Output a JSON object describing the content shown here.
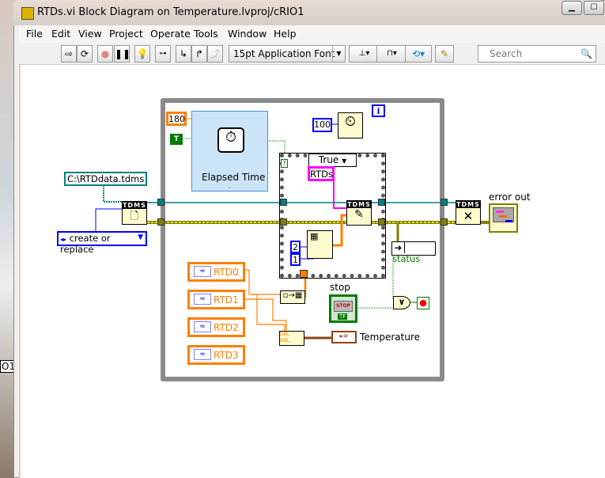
{
  "window": {
    "title": "RTDs.vi Block Diagram on Temperature.lvproj/cRIO1",
    "minimize": "▁",
    "maximize": "☐"
  },
  "menu": [
    "File",
    "Edit",
    "View",
    "Project",
    "Operate",
    "Tools",
    "Window",
    "Help"
  ],
  "toolbar": {
    "font_select": "15pt Application Font",
    "search_placeholder": "Search",
    "icons": [
      "run-arrow-icon",
      "run-continuously-icon",
      "abort-icon",
      "pause-icon",
      "highlight-execution-icon",
      "retain-wire-values-icon",
      "step-into-icon",
      "step-over-icon",
      "step-out-icon",
      "align-objects-icon",
      "distribute-objects-icon",
      "reorder-icon",
      "cleanup-diagram-icon",
      "search-icon"
    ]
  },
  "diagram": {
    "loop_index": "i",
    "const_180": "180",
    "const_true": "T",
    "elapsed_time": "Elapsed Time",
    "const_100": "100",
    "case_selector": "True",
    "rtds_const": "RTDs",
    "const_2": "2",
    "const_1": "1",
    "tdms": "TDMS",
    "path_const": "C:\\RTDdata.tdms",
    "enum_const": "create or replace",
    "error_out": "error out",
    "status": "status",
    "rtd": [
      "RTD0",
      "RTD1",
      "RTD2",
      "RTD3"
    ],
    "stop_label": "stop",
    "stop_button": "STOP",
    "stop_tf": "TF",
    "temperature": "Temperature",
    "dbl": "DBL",
    "or": "∨",
    "side_text": "O1"
  },
  "colors": {
    "loop": "#8a8a8a",
    "int_const": "#0000ff",
    "dbl_wire": "#ff7f00",
    "bool": "#007a00",
    "string": "#ff00ff",
    "refnum": "#008080",
    "error": "#808000"
  }
}
